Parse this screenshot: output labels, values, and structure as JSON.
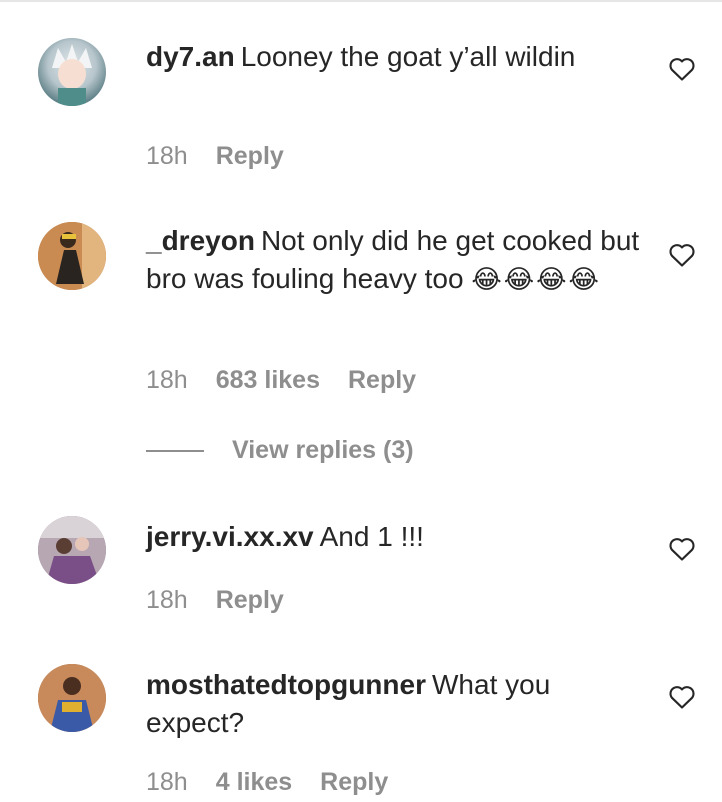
{
  "comments": [
    {
      "username": "dy7.an",
      "text": "Looney the goat y’all wildin",
      "emojis": "",
      "time": "18h",
      "likes": "",
      "reply_label": "Reply",
      "avatar_icon": "anime-character-avatar"
    },
    {
      "username": "_dreyon",
      "text": "Not only did he get cooked but bro was fouling heavy too",
      "emojis": "😂😂😂😂",
      "time": "18h",
      "likes": "683 likes",
      "reply_label": "Reply",
      "avatar_icon": "person-photo-avatar"
    },
    {
      "username": "jerry.vi.xx.xv",
      "text": "And 1 !!!",
      "emojis": "",
      "time": "18h",
      "likes": "",
      "reply_label": "Reply",
      "avatar_icon": "group-photo-avatar"
    },
    {
      "username": "mosthatedtopgunner",
      "text": "What you expect?",
      "emojis": "",
      "time": "18h",
      "likes": "4 likes",
      "reply_label": "Reply",
      "avatar_icon": "person-photo-avatar"
    }
  ],
  "view_replies_label": "View replies (3)",
  "colors": {
    "text": "#262626",
    "meta": "#8e8e8e",
    "background": "#ffffff"
  }
}
